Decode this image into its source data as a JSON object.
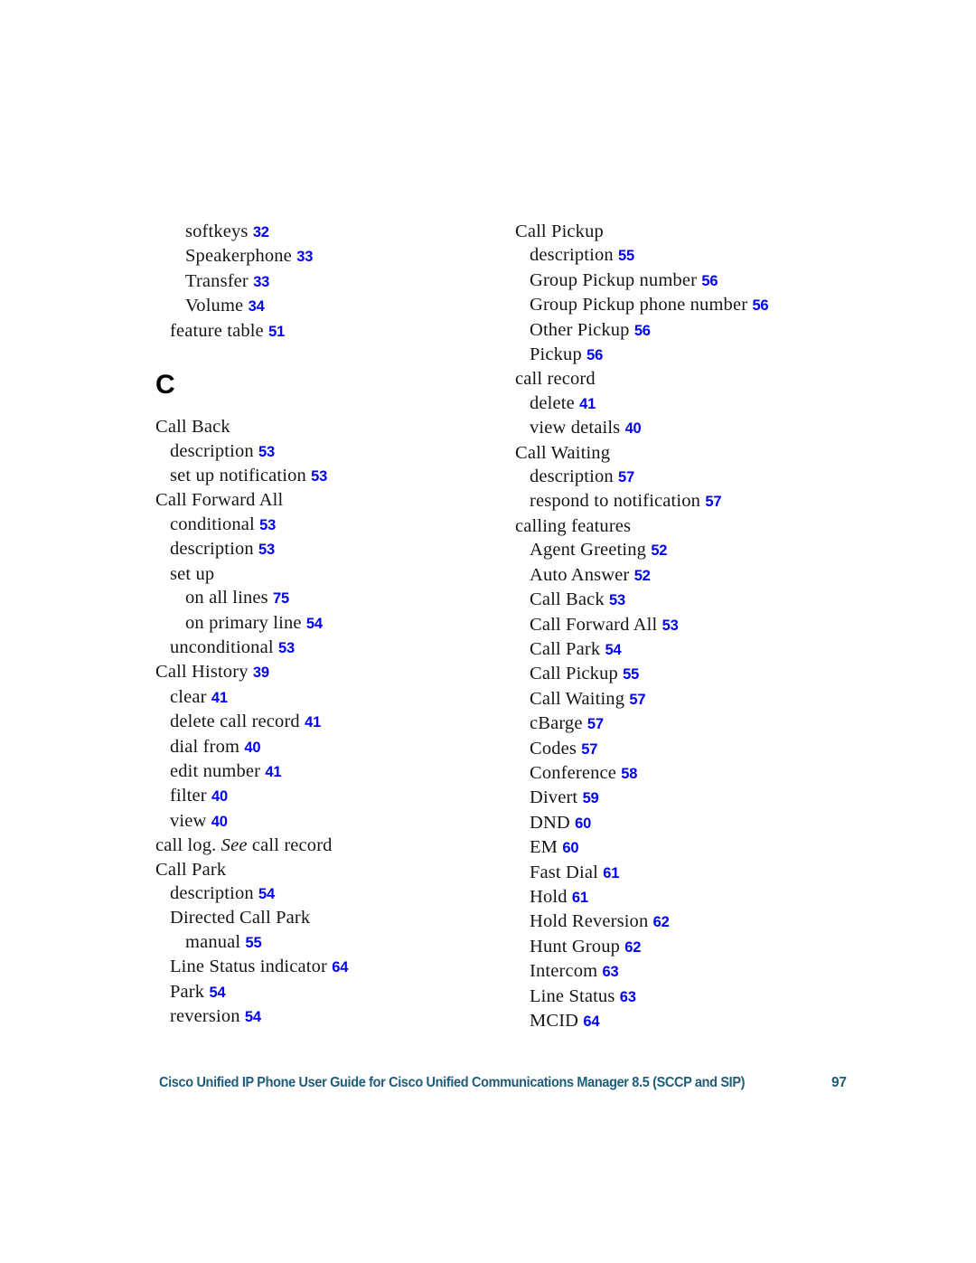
{
  "letter_heading": "C",
  "columns": {
    "left": [
      {
        "label": "softkeys",
        "page": "32",
        "level": 2
      },
      {
        "label": "Speakerphone",
        "page": "33",
        "level": 2
      },
      {
        "label": "Transfer",
        "page": "33",
        "level": 2
      },
      {
        "label": "Volume",
        "page": "34",
        "level": 2
      },
      {
        "label": "feature table",
        "page": "51",
        "level": 1
      },
      {
        "label": "",
        "page": "",
        "level": 0,
        "spacer": true
      },
      {
        "label": "",
        "page": "",
        "level": 0,
        "spacer": true
      },
      {
        "label": "",
        "page": "",
        "level": 0,
        "spacer": true
      },
      {
        "label": "Call Back",
        "page": "",
        "level": 0
      },
      {
        "label": "description",
        "page": "53",
        "level": 1
      },
      {
        "label": "set up notification",
        "page": "53",
        "level": 1
      },
      {
        "label": "Call Forward All",
        "page": "",
        "level": 0
      },
      {
        "label": "conditional",
        "page": "53",
        "level": 1
      },
      {
        "label": "description",
        "page": "53",
        "level": 1
      },
      {
        "label": "set up",
        "page": "",
        "level": 1
      },
      {
        "label": "on all lines",
        "page": "75",
        "level": 2
      },
      {
        "label": "on primary line",
        "page": "54",
        "level": 2
      },
      {
        "label": "unconditional",
        "page": "53",
        "level": 1
      },
      {
        "label": "Call History",
        "page": "39",
        "level": 0
      },
      {
        "label": "clear",
        "page": "41",
        "level": 1
      },
      {
        "label": "delete call record",
        "page": "41",
        "level": 1
      },
      {
        "label": "dial from",
        "page": "40",
        "level": 1
      },
      {
        "label": "edit number",
        "page": "41",
        "level": 1
      },
      {
        "label": "filter",
        "page": "40",
        "level": 1
      },
      {
        "label": "view",
        "page": "40",
        "level": 1
      },
      {
        "label": "call log. ",
        "page": "",
        "level": 0,
        "italic": "See",
        "after": " call record"
      },
      {
        "label": "Call Park",
        "page": "",
        "level": 0
      },
      {
        "label": "description",
        "page": "54",
        "level": 1
      },
      {
        "label": "Directed Call Park",
        "page": "",
        "level": 1
      },
      {
        "label": "manual",
        "page": "55",
        "level": 2
      },
      {
        "label": "Line Status indicator",
        "page": "64",
        "level": 1
      },
      {
        "label": "Park",
        "page": "54",
        "level": 1
      },
      {
        "label": "reversion",
        "page": "54",
        "level": 1
      }
    ],
    "right": [
      {
        "label": "Call Pickup",
        "page": "",
        "level": 0
      },
      {
        "label": "description",
        "page": "55",
        "level": 1
      },
      {
        "label": "Group Pickup number",
        "page": "56",
        "level": 1
      },
      {
        "label": "Group Pickup phone number",
        "page": "56",
        "level": 1
      },
      {
        "label": "Other Pickup",
        "page": "56",
        "level": 1
      },
      {
        "label": "Pickup",
        "page": "56",
        "level": 1
      },
      {
        "label": "call record",
        "page": "",
        "level": 0
      },
      {
        "label": "delete",
        "page": "41",
        "level": 1
      },
      {
        "label": "view details",
        "page": "40",
        "level": 1
      },
      {
        "label": "Call Waiting",
        "page": "",
        "level": 0
      },
      {
        "label": "description",
        "page": "57",
        "level": 1
      },
      {
        "label": "respond to notification",
        "page": "57",
        "level": 1
      },
      {
        "label": "calling features",
        "page": "",
        "level": 0
      },
      {
        "label": "Agent Greeting",
        "page": "52",
        "level": 1
      },
      {
        "label": "Auto Answer",
        "page": "52",
        "level": 1
      },
      {
        "label": "Call Back",
        "page": "53",
        "level": 1
      },
      {
        "label": "Call Forward All",
        "page": "53",
        "level": 1
      },
      {
        "label": "Call Park",
        "page": "54",
        "level": 1
      },
      {
        "label": "Call Pickup",
        "page": "55",
        "level": 1
      },
      {
        "label": "Call Waiting",
        "page": "57",
        "level": 1
      },
      {
        "label": "cBarge",
        "page": "57",
        "level": 1
      },
      {
        "label": "Codes",
        "page": "57",
        "level": 1
      },
      {
        "label": "Conference",
        "page": "58",
        "level": 1
      },
      {
        "label": "Divert",
        "page": "59",
        "level": 1
      },
      {
        "label": "DND",
        "page": "60",
        "level": 1
      },
      {
        "label": "EM",
        "page": "60",
        "level": 1
      },
      {
        "label": "Fast Dial",
        "page": "61",
        "level": 1
      },
      {
        "label": "Hold",
        "page": "61",
        "level": 1
      },
      {
        "label": "Hold Reversion",
        "page": "62",
        "level": 1
      },
      {
        "label": "Hunt Group",
        "page": "62",
        "level": 1
      },
      {
        "label": "Intercom",
        "page": "63",
        "level": 1
      },
      {
        "label": "Line Status",
        "page": "63",
        "level": 1
      },
      {
        "label": "MCID",
        "page": "64",
        "level": 1
      }
    ]
  },
  "footer": {
    "title": "Cisco Unified IP Phone User Guide for Cisco Unified Communications Manager 8.5 (SCCP and SIP)",
    "page_number": "97"
  },
  "colors": {
    "page_number_link": "#0000ff",
    "footer_text": "#1f5c7a",
    "body_text": "#161616"
  }
}
